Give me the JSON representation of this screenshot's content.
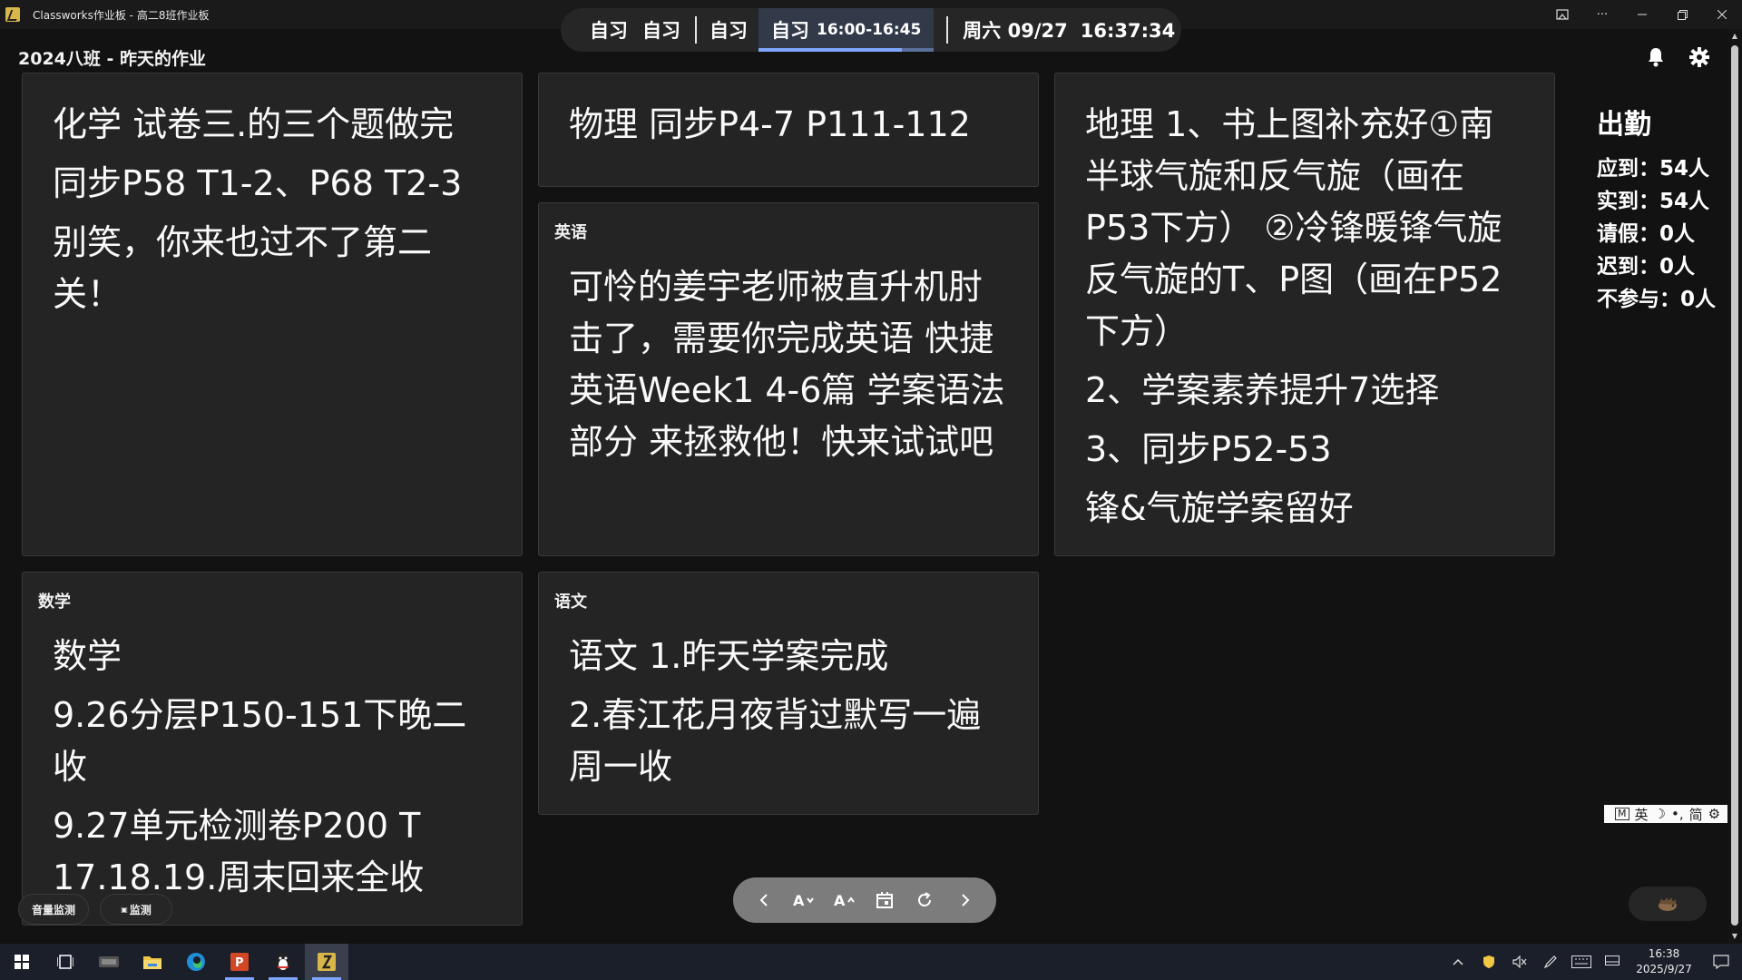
{
  "window": {
    "title": "Classworks作业板 - 高二8班作业板"
  },
  "header": {
    "title": "2024八班 - 昨天的作业"
  },
  "schedule": {
    "items": [
      "自习",
      "自习",
      "自习"
    ],
    "current_label": "自习",
    "current_time": "16:00-16:45",
    "progress": 0.82,
    "weekday_date": "周六 09/27",
    "clock": "16:37:34"
  },
  "cards": {
    "chemistry": {
      "lines": [
        "化学 试卷三.的三个题做完",
        "同步P58 T1-2、P68 T2-3",
        "别笑，你来也过不了第二关！"
      ]
    },
    "physics": {
      "lines": [
        "物理 同步P4-7 P111-112"
      ]
    },
    "english": {
      "label": "英语",
      "lines": [
        "可怜的姜宇老师被直升机肘击了，需要你完成英语 快捷英语Week1 4-6篇 学案语法部分 来拯救他！快来试试吧"
      ]
    },
    "geography": {
      "lines": [
        "地理 1、书上图补充好①南半球气旋和反气旋（画在P53下方） ②冷锋暖锋气旋反气旋的T、P图（画在P52下方）",
        "2、学案素养提升7选择",
        "3、同步P52-53",
        "锋&气旋学案留好"
      ]
    },
    "math": {
      "label": "数学",
      "lines": [
        "数学",
        "9.26分层P150-151下晚二收",
        "9.27单元检测卷P200 T 17.18.19.周末回来全收"
      ]
    },
    "chinese": {
      "label": "语文",
      "lines": [
        "语文 1.昨天学案完成",
        "2.春江花月夜背过默写一遍 周一收"
      ]
    }
  },
  "attendance": {
    "title": "出勤",
    "expected": "应到：54人",
    "actual": "实到：54人",
    "leave": "请假：0人",
    "late": "迟到：0人",
    "absent": "不参与：0人"
  },
  "chips": {
    "volume_monitor": "音量监测",
    "monitor": "监测"
  },
  "ime": {
    "mode": "英",
    "simp": "简"
  },
  "tray": {
    "time": "16:38",
    "date": "2025/9/27"
  },
  "colors": {
    "accent": "#7fa6ff",
    "card_bg": "#242424",
    "bg": "#121212"
  }
}
